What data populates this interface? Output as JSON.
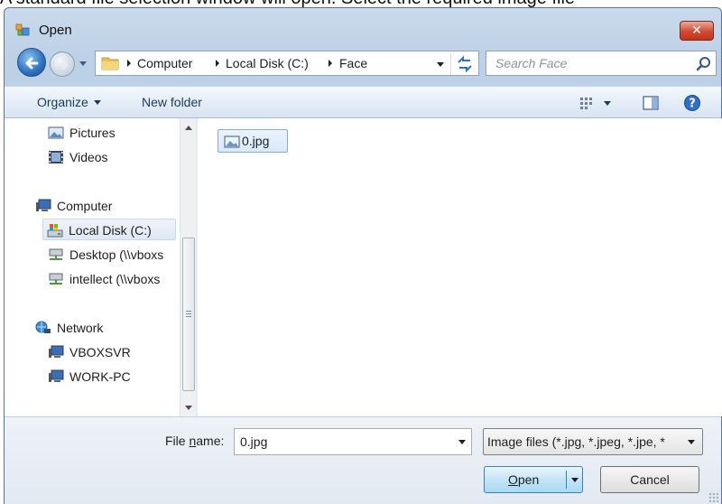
{
  "caption": "A standard file selection window will open. Select the required image file",
  "window": {
    "title": "Open",
    "close_symbol": "✕"
  },
  "address": {
    "crumbs": [
      "Computer",
      "Local Disk (C:)",
      "Face"
    ],
    "search_placeholder": "Search Face"
  },
  "toolbar": {
    "organize": "Organize",
    "new_folder": "New folder"
  },
  "nav": {
    "items": [
      {
        "label": "Pictures",
        "icon": "pictures-icon"
      },
      {
        "label": "Videos",
        "icon": "videos-icon"
      },
      {
        "label": "Computer",
        "icon": "computer-icon"
      },
      {
        "label": "Local Disk (C:)",
        "icon": "drive-icon",
        "selected": true
      },
      {
        "label": "Desktop (\\\\vboxs",
        "icon": "network-drive-icon"
      },
      {
        "label": "intellect (\\\\vboxs",
        "icon": "network-drive-icon"
      },
      {
        "label": "Network",
        "icon": "network-icon"
      },
      {
        "label": "VBOXSVR",
        "icon": "computer-icon"
      },
      {
        "label": "WORK-PC",
        "icon": "computer-icon"
      }
    ]
  },
  "files": [
    {
      "name": "0.jpg",
      "icon": "image-file-icon",
      "selected": true
    }
  ],
  "bottom": {
    "filename_label_pre": "File ",
    "filename_label_accel": "n",
    "filename_label_post": "ame:",
    "filename_value": "0.jpg",
    "filter_value": "Image files (*.jpg, *.jpeg, *.jpe, *",
    "open_accel": "O",
    "open_rest": "pen",
    "cancel": "Cancel"
  },
  "colors": {
    "accent": "#3c7fb1",
    "close": "#d24a32",
    "selection": "#d8e9fb"
  }
}
